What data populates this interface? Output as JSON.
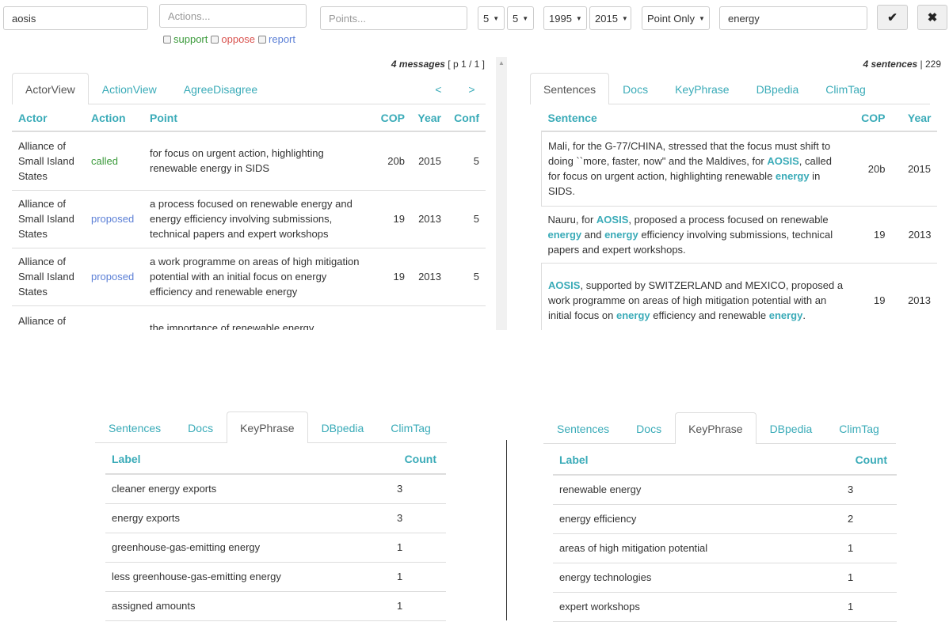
{
  "toolbar": {
    "actor_value": "aosis",
    "actions_placeholder": "Actions...",
    "points_placeholder": "Points...",
    "filter_a": "5",
    "filter_b": "5",
    "year_from": "1995",
    "year_to": "2015",
    "mode": "Point Only",
    "keyword_value": "energy",
    "checkboxes": [
      {
        "label": "support",
        "color": "#3a9a3a"
      },
      {
        "label": "oppose",
        "color": "#d9534f"
      },
      {
        "label": "report",
        "color": "#5b7fd6"
      }
    ]
  },
  "left_panel": {
    "summary_count": "4 messages",
    "summary_page": " [ p 1 / 1 ]",
    "tabs": [
      "ActorView",
      "ActionView",
      "AgreeDisagree"
    ],
    "prev": "<",
    "next": ">",
    "columns": [
      "Actor",
      "Action",
      "Point",
      "COP",
      "Year",
      "Conf"
    ],
    "rows": [
      {
        "actor": "Alliance of Small Island States",
        "action": "called",
        "action_color": "#3a9a3a",
        "point": "for focus on urgent action, highlighting renewable energy in SIDS",
        "cop": "20b",
        "year": "2015",
        "conf": "5"
      },
      {
        "actor": "Alliance of Small Island States",
        "action": "proposed",
        "action_color": "#5b7fd6",
        "point": "a process focused on renewable energy and energy efficiency involving submissions, technical papers and expert workshops",
        "cop": "19",
        "year": "2013",
        "conf": "5"
      },
      {
        "actor": "Alliance of Small Island States",
        "action": "proposed",
        "action_color": "#5b7fd6",
        "point": "a work programme on areas of high mitigation potential with an initial focus on energy efficiency and renewable energy",
        "cop": "19",
        "year": "2013",
        "conf": "5"
      },
      {
        "actor": "Alliance of",
        "action": "",
        "action_color": "#5b7fd6",
        "point": "the importance of renewable energy",
        "cop": "",
        "year": "",
        "conf": ""
      }
    ]
  },
  "right_panel": {
    "summary_count": "4 sentences",
    "summary_total": " | 229",
    "tabs": [
      "Sentences",
      "Docs",
      "KeyPhrase",
      "DBpedia",
      "ClimTag"
    ],
    "columns": [
      "Sentence",
      "COP",
      "Year"
    ],
    "rows": [
      {
        "parts": [
          {
            "t": "Mali, for the G-77/CHINA, stressed that the focus must shift to doing ``more, faster, now\" and the Maldives, for "
          },
          {
            "t": "AOSIS",
            "h": true
          },
          {
            "t": ", called for focus on urgent action, highlighting renewable "
          },
          {
            "t": "energy",
            "h": true
          },
          {
            "t": " in SIDS."
          }
        ],
        "cop": "20b",
        "year": "2015"
      },
      {
        "parts": [
          {
            "t": "Nauru, for "
          },
          {
            "t": "AOSIS",
            "h": true
          },
          {
            "t": ", proposed a process focused on renewable "
          },
          {
            "t": "energy",
            "h": true
          },
          {
            "t": " and "
          },
          {
            "t": "energy",
            "h": true
          },
          {
            "t": " efficiency involving submissions, technical papers and expert workshops."
          }
        ],
        "cop": "19",
        "year": "2013"
      },
      {
        "parts": [
          {
            "t": "AOSIS",
            "h": true
          },
          {
            "t": ", supported by SWITZERLAND and MEXICO, proposed a work programme on areas of high mitigation potential with an initial focus on "
          },
          {
            "t": "energy",
            "h": true
          },
          {
            "t": " efficiency and renewable "
          },
          {
            "t": "energy",
            "h": true
          },
          {
            "t": "."
          }
        ],
        "cop": "19",
        "year": "2013"
      }
    ]
  },
  "bottom_left": {
    "tabs": [
      "Sentences",
      "Docs",
      "KeyPhrase",
      "DBpedia",
      "ClimTag"
    ],
    "columns": [
      "Label",
      "Count"
    ],
    "rows": [
      {
        "label": "cleaner energy exports",
        "count": "3"
      },
      {
        "label": "energy exports",
        "count": "3"
      },
      {
        "label": "greenhouse-gas-emitting energy",
        "count": "1"
      },
      {
        "label": "less greenhouse-gas-emitting energy",
        "count": "1"
      },
      {
        "label": "assigned amounts",
        "count": "1"
      }
    ]
  },
  "bottom_right": {
    "tabs": [
      "Sentences",
      "Docs",
      "KeyPhrase",
      "DBpedia",
      "ClimTag"
    ],
    "columns": [
      "Label",
      "Count"
    ],
    "rows": [
      {
        "label": "renewable energy",
        "count": "3"
      },
      {
        "label": "energy efficiency",
        "count": "2"
      },
      {
        "label": "areas of high mitigation potential",
        "count": "1"
      },
      {
        "label": "energy technologies",
        "count": "1"
      },
      {
        "label": "expert workshops",
        "count": "1"
      }
    ]
  }
}
